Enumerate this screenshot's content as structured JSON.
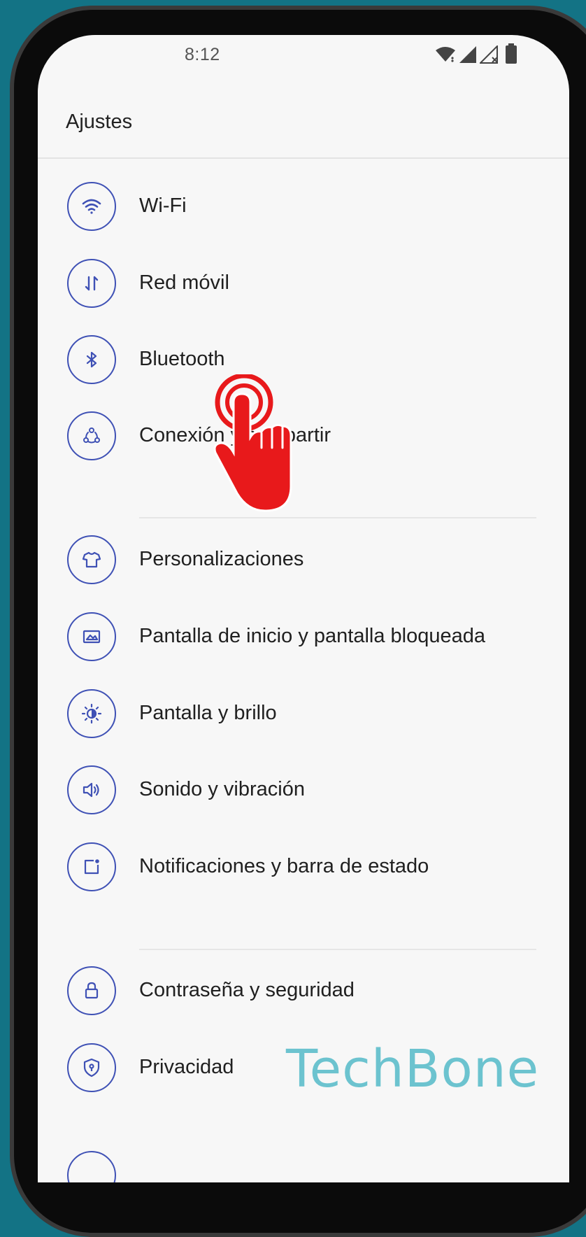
{
  "status_bar": {
    "time": "8:12",
    "icons": [
      "wifi-icon",
      "signal-icon",
      "signal-no-service-icon",
      "battery-icon"
    ]
  },
  "header": {
    "title": "Ajustes"
  },
  "sections": [
    {
      "items": [
        {
          "icon": "wifi-icon",
          "label": "Wi-Fi"
        },
        {
          "icon": "mobile-data-icon",
          "label": "Red móvil"
        },
        {
          "icon": "bluetooth-icon",
          "label": "Bluetooth"
        },
        {
          "icon": "share-connection-icon",
          "label": "Conexión y compartir"
        }
      ]
    },
    {
      "items": [
        {
          "icon": "tshirt-icon",
          "label": "Personalizaciones"
        },
        {
          "icon": "wallpaper-icon",
          "label": "Pantalla de inicio y pantalla bloqueada"
        },
        {
          "icon": "brightness-icon",
          "label": "Pantalla y brillo"
        },
        {
          "icon": "sound-icon",
          "label": "Sonido y vibración"
        },
        {
          "icon": "notification-icon",
          "label": "Notificaciones y barra de estado"
        }
      ]
    },
    {
      "items": [
        {
          "icon": "lock-icon",
          "label": "Contraseña y seguridad"
        },
        {
          "icon": "privacy-shield-icon",
          "label": "Privacidad"
        }
      ]
    }
  ],
  "overlay": {
    "gesture": "tap-hand-icon",
    "watermark": "TechBone"
  },
  "colors": {
    "icon_accent": "#3f51b5",
    "background": "#137385",
    "screen": "#f7f7f7",
    "tap_hand": "#e8191b",
    "watermark": "#6cc3cf"
  }
}
